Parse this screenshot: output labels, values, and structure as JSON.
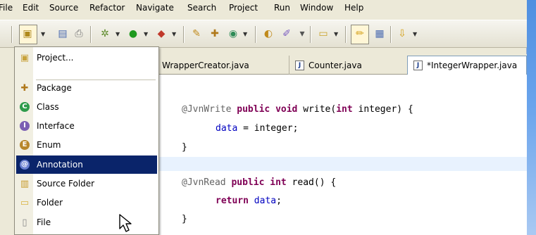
{
  "menubar": {
    "items": [
      "File",
      "Edit",
      "Source",
      "Refactor",
      "Navigate",
      "Search",
      "Project",
      "Run",
      "Window",
      "Help"
    ]
  },
  "toolbar": {
    "icons": [
      "new-wizard-icon",
      "save-icon",
      "print-icon",
      "debug-icon",
      "run-icon",
      "external-tools-icon",
      "new-java-project-icon",
      "new-java-package-icon",
      "new-java-class-icon",
      "open-type-icon",
      "search-icon",
      "open-task-icon",
      "mark-occurrences-icon",
      "show-whitespace-icon",
      "next-annotation-icon"
    ]
  },
  "tabs": [
    {
      "label": "WrapperCreator.java",
      "active": false
    },
    {
      "label": "Counter.java",
      "active": false
    },
    {
      "label": "*IntegerWrapper.java",
      "active": true
    }
  ],
  "menu": {
    "items": [
      {
        "label": "Project...",
        "icon": "new-project-icon"
      },
      {
        "label": "Package",
        "icon": "package-icon"
      },
      {
        "label": "Class",
        "icon": "class-icon"
      },
      {
        "label": "Interface",
        "icon": "interface-icon"
      },
      {
        "label": "Enum",
        "icon": "enum-icon"
      },
      {
        "label": "Annotation",
        "icon": "annotation-icon",
        "selected": true
      },
      {
        "label": "Source Folder",
        "icon": "source-folder-icon"
      },
      {
        "label": "Folder",
        "icon": "folder-icon"
      },
      {
        "label": "File",
        "icon": "file-icon"
      }
    ]
  },
  "code": {
    "line1": {
      "annotation": "@JvnWrite",
      "kw1": "public",
      "kw2": "void",
      "rest1": " write(",
      "kw3": "int",
      "rest2": " integer) {"
    },
    "line2": {
      "field": "data",
      "rest": " = integer;"
    },
    "line3": "}",
    "line4": {
      "annotation": "@JvnRead",
      "kw1": "public",
      "kw2": "int",
      "rest": " read() {"
    },
    "line5": {
      "kw": "return",
      "field": "data",
      "rest": ";"
    },
    "line6": "}"
  },
  "colors": {
    "keyword": "#7f0055",
    "annotation": "#646464",
    "field": "#0000c0",
    "menu_selected": "#0a246a"
  }
}
